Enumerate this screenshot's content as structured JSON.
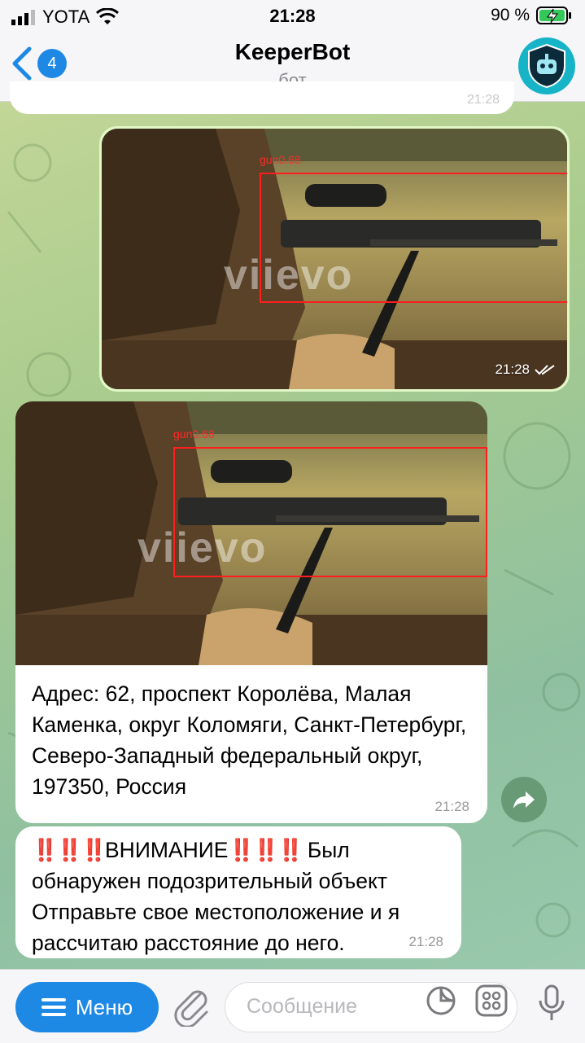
{
  "status_bar": {
    "carrier": "YOTA",
    "time": "21:28",
    "battery_percent": "90 %"
  },
  "header": {
    "back_badge": "4",
    "title": "KeeperBot",
    "subtitle": "бот"
  },
  "messages": {
    "prev_time": "21:28",
    "sent_photo": {
      "time": "21:28",
      "detection_label": "gun0.68",
      "watermark": "viievo"
    },
    "received_photo": {
      "detection_label": "gun0.68",
      "watermark": "viievo",
      "caption": "Адрес: 62, проспект Королёва, Малая Каменка, округ Коломяги, Санкт-Петербург, Северо-Западный федеральный округ, 197350, Россия",
      "time": "21:28"
    },
    "alert": {
      "marks": "‼️‼️‼️",
      "title": "ВНИМАНИЕ",
      "text": "Был обнаружен подозрительный объект Отправьте свое местоположение и я рассчитаю расстояние до него.",
      "time": "21:28"
    }
  },
  "bottom_bar": {
    "menu_label": "Меню",
    "input_placeholder": "Сообщение"
  },
  "colors": {
    "accent": "#1e88e5",
    "outgoing_bubble": "#e1f7c6",
    "incoming_bubble": "#ffffff",
    "avatar": "#17b4c8",
    "detection_box": "#ff1e1e"
  }
}
